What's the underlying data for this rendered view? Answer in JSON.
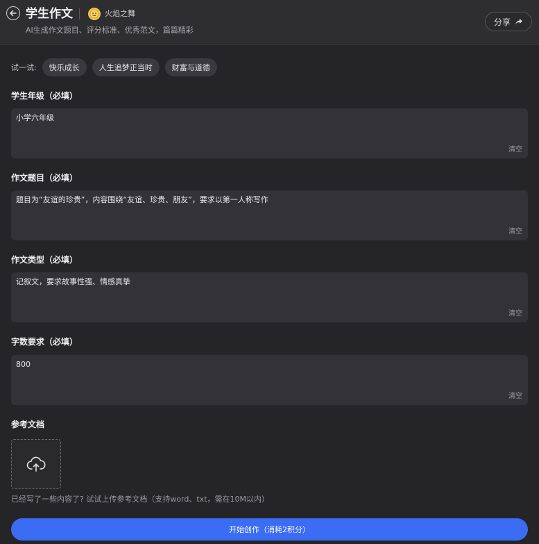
{
  "header": {
    "title": "学生作文",
    "author": "火焰之舞",
    "subtitle": "AI生成作文题目、评分标准、优秀范文，篇篇精彩",
    "share_label": "分享"
  },
  "try": {
    "label": "试一试:",
    "chips": [
      "快乐成长",
      "人生追梦正当时",
      "财富与道德"
    ]
  },
  "fields": [
    {
      "label": "学生年级（必填）",
      "value": "小学六年级",
      "clear": "清空"
    },
    {
      "label": "作文题目（必填）",
      "value": "题目为“友谊的珍贵”，内容围绕“友谊、珍贵、朋友”，要求以第一人称写作",
      "clear": "清空"
    },
    {
      "label": "作文类型（必填）",
      "value": "记叙文，要求故事性强、情感真挚",
      "clear": "清空"
    },
    {
      "label": "字数要求（必填）",
      "value": "800",
      "clear": "清空"
    }
  ],
  "reference": {
    "label": "参考文档",
    "hint": "已经写了一些内容了? 试试上传参考文档（支持word、txt，需在10M以内）"
  },
  "start_button": "开始创作（消耗2积分）",
  "colors": {
    "accent": "#3a6cf4",
    "background": "#252528",
    "field_bg": "#333337"
  }
}
